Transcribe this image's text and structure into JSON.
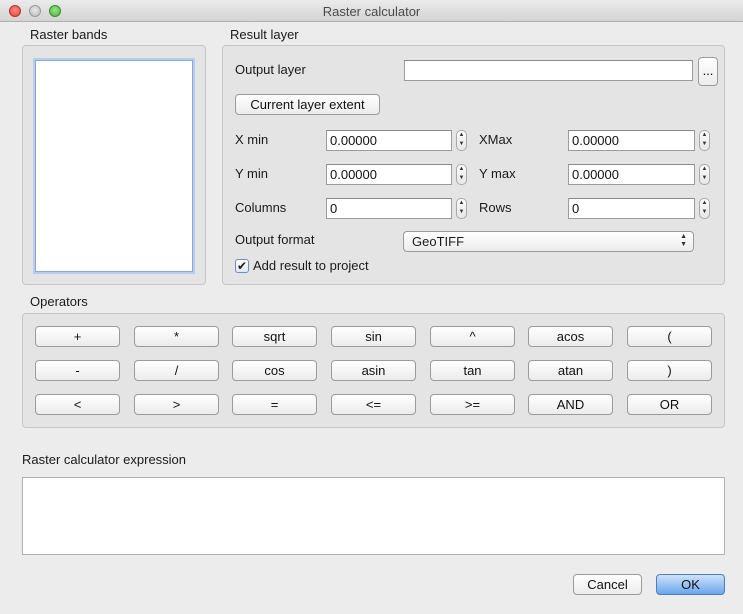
{
  "window": {
    "title": "Raster calculator"
  },
  "raster_bands": {
    "label": "Raster bands"
  },
  "result_layer": {
    "label": "Result layer",
    "output_layer_label": "Output layer",
    "output_layer_value": "",
    "browse_label": "...",
    "current_extent_label": "Current layer extent",
    "xmin_label": "X min",
    "xmin_value": "0.00000",
    "xmax_label": "XMax",
    "xmax_value": "0.00000",
    "ymin_label": "Y min",
    "ymin_value": "0.00000",
    "ymax_label": "Y max",
    "ymax_value": "0.00000",
    "columns_label": "Columns",
    "columns_value": "0",
    "rows_label": "Rows",
    "rows_value": "0",
    "output_format_label": "Output format",
    "output_format_value": "GeoTIFF",
    "add_result_label": "Add result to project",
    "add_result_checked": true
  },
  "operators": {
    "label": "Operators",
    "row1": [
      "+",
      "*",
      "sqrt",
      "sin",
      "^",
      "acos",
      "("
    ],
    "row2": [
      "-",
      "/",
      "cos",
      "asin",
      "tan",
      "atan",
      ")"
    ],
    "row3": [
      "<",
      ">",
      "=",
      "<=",
      ">=",
      "AND",
      "OR"
    ]
  },
  "expression": {
    "label": "Raster calculator expression",
    "value": ""
  },
  "footer": {
    "cancel_label": "Cancel",
    "ok_label": "OK"
  },
  "colors": {
    "ok_accent": "#6aa5ec",
    "close_red": "#e0443a",
    "max_green": "#4bb33a"
  }
}
